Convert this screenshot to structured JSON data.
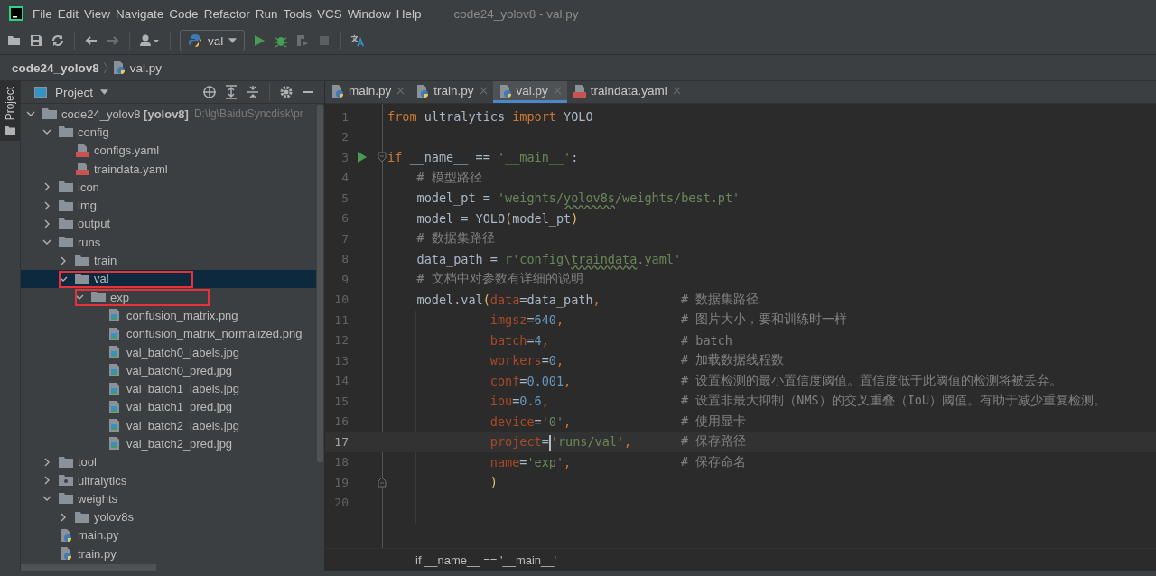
{
  "window": {
    "title": "code24_yolov8 - val.py"
  },
  "menu": [
    "File",
    "Edit",
    "View",
    "Navigate",
    "Code",
    "Refactor",
    "Run",
    "Tools",
    "VCS",
    "Window",
    "Help"
  ],
  "toolbar": {
    "run_config": "val"
  },
  "breadcrumb": [
    "code24_yolov8",
    "val.py"
  ],
  "side_tab": {
    "label": "Project",
    "selected": true
  },
  "project_panel": {
    "title": "Project"
  },
  "tree": [
    {
      "kind": "folder",
      "label": "code24_yolov8 **[yolov8]**",
      "path": "D:\\lg\\BaiduSyncdisk\\pr",
      "expanded": true,
      "selected": false,
      "boxed": false,
      "children": [
        {
          "kind": "folder",
          "label": "config",
          "expanded": true,
          "selected": false,
          "boxed": false,
          "children": [
            {
              "kind": "yaml",
              "label": "configs.yaml",
              "selected": false,
              "boxed": false
            },
            {
              "kind": "yaml",
              "label": "traindata.yaml",
              "selected": false,
              "boxed": false
            }
          ]
        },
        {
          "kind": "folder",
          "label": "icon",
          "expanded": false,
          "selected": false,
          "boxed": false
        },
        {
          "kind": "folder",
          "label": "img",
          "expanded": false,
          "selected": false,
          "boxed": false
        },
        {
          "kind": "folder",
          "label": "output",
          "expanded": false,
          "selected": false,
          "boxed": false
        },
        {
          "kind": "folder",
          "label": "runs",
          "expanded": true,
          "selected": false,
          "boxed": false,
          "children": [
            {
              "kind": "folder",
              "label": "train",
              "expanded": false,
              "selected": false,
              "boxed": false
            },
            {
              "kind": "folder",
              "label": "val",
              "expanded": true,
              "selected": true,
              "boxed": true,
              "children": [
                {
                  "kind": "folder",
                  "label": "exp",
                  "expanded": true,
                  "selected": false,
                  "boxed": true,
                  "children": [
                    {
                      "kind": "image",
                      "label": "confusion_matrix.png",
                      "selected": false,
                      "boxed": false
                    },
                    {
                      "kind": "image",
                      "label": "confusion_matrix_normalized.png",
                      "selected": false,
                      "boxed": false
                    },
                    {
                      "kind": "image",
                      "label": "val_batch0_labels.jpg",
                      "selected": false,
                      "boxed": false
                    },
                    {
                      "kind": "image",
                      "label": "val_batch0_pred.jpg",
                      "selected": false,
                      "boxed": false
                    },
                    {
                      "kind": "image",
                      "label": "val_batch1_labels.jpg",
                      "selected": false,
                      "boxed": false
                    },
                    {
                      "kind": "image",
                      "label": "val_batch1_pred.jpg",
                      "selected": false,
                      "boxed": false
                    },
                    {
                      "kind": "image",
                      "label": "val_batch2_labels.jpg",
                      "selected": false,
                      "boxed": false
                    },
                    {
                      "kind": "image",
                      "label": "val_batch2_pred.jpg",
                      "selected": false,
                      "boxed": false
                    }
                  ]
                }
              ]
            }
          ]
        },
        {
          "kind": "folder",
          "label": "tool",
          "expanded": false,
          "selected": false,
          "boxed": false
        },
        {
          "kind": "package",
          "label": "ultralytics",
          "expanded": false,
          "selected": false,
          "boxed": false
        },
        {
          "kind": "folder",
          "label": "weights",
          "expanded": true,
          "selected": false,
          "boxed": false,
          "children": [
            {
              "kind": "folder",
              "label": "yolov8s",
              "expanded": false,
              "selected": false,
              "boxed": false
            }
          ]
        },
        {
          "kind": "python",
          "label": "main.py",
          "selected": false,
          "boxed": false
        },
        {
          "kind": "python",
          "label": "train.py",
          "selected": false,
          "boxed": false
        }
      ]
    }
  ],
  "tabs": [
    {
      "kind": "python",
      "label": "main.py",
      "selected": false
    },
    {
      "kind": "python",
      "label": "train.py",
      "selected": false
    },
    {
      "kind": "python",
      "label": "val.py",
      "selected": true
    },
    {
      "kind": "yaml",
      "label": "traindata.yaml",
      "selected": false
    }
  ],
  "code_lines": [
    {
      "number": "1",
      "run": false,
      "current": false,
      "tokens": [
        {
          "kind": "kw",
          "text": "from"
        },
        {
          "kind": "plain",
          "text": " ultralytics "
        },
        {
          "kind": "kw",
          "text": "import"
        },
        {
          "kind": "plain",
          "text": " YOLO"
        }
      ]
    },
    {
      "number": "2",
      "run": false,
      "current": false
    },
    {
      "number": "3",
      "run": true,
      "current": false,
      "fold_start": true,
      "tokens": [
        {
          "kind": "kw",
          "text": "if"
        },
        {
          "kind": "plain",
          "text": " __name__ == "
        },
        {
          "kind": "str",
          "text": "'__main__'"
        },
        {
          "kind": "plain",
          "text": ":"
        }
      ]
    },
    {
      "number": "4",
      "run": false,
      "current": false,
      "tokens": [
        {
          "kind": "comment",
          "text": "    # 模型路径"
        }
      ]
    },
    {
      "number": "5",
      "run": false,
      "current": false,
      "tokens": [
        {
          "kind": "plain",
          "text": "    model_pt = "
        },
        {
          "kind": "str",
          "text": "'weights/"
        },
        {
          "kind": "str",
          "text": "yolov8s",
          "squiggle": true
        },
        {
          "kind": "str",
          "text": "/weights/best.pt'"
        }
      ]
    },
    {
      "number": "6",
      "run": false,
      "current": false,
      "tokens": [
        {
          "kind": "plain",
          "text": "    model = YOLO"
        },
        {
          "kind": "paren",
          "text": "("
        },
        {
          "kind": "plain",
          "text": "model_pt"
        },
        {
          "kind": "paren",
          "text": ")"
        }
      ]
    },
    {
      "number": "7",
      "run": false,
      "current": false,
      "tokens": [
        {
          "kind": "comment",
          "text": "    # 数据集路径"
        }
      ]
    },
    {
      "number": "8",
      "run": false,
      "current": false,
      "tokens": [
        {
          "kind": "plain",
          "text": "    data_path = "
        },
        {
          "kind": "str",
          "text": "r'config\\"
        },
        {
          "kind": "str",
          "text": "traindata",
          "squiggle": true
        },
        {
          "kind": "str",
          "text": ".yaml'"
        }
      ]
    },
    {
      "number": "9",
      "run": false,
      "current": false,
      "tokens": [
        {
          "kind": "comment",
          "text": "    # 文档中对参数有详细的说明"
        }
      ]
    },
    {
      "number": "10",
      "run": false,
      "current": false,
      "comment": "# 数据集路径",
      "tokens": [
        {
          "kind": "plain",
          "text": "    model.val"
        },
        {
          "kind": "paren",
          "text": "("
        },
        {
          "kind": "param",
          "text": "data"
        },
        {
          "kind": "plain",
          "text": "=data_path"
        },
        {
          "kind": "kw",
          "text": ","
        }
      ]
    },
    {
      "number": "11",
      "run": false,
      "current": false,
      "comment": "# 图片大小，要和训练时一样",
      "tokens": [
        {
          "kind": "param",
          "text": "              imgsz"
        },
        {
          "kind": "plain",
          "text": "="
        },
        {
          "kind": "num",
          "text": "640"
        },
        {
          "kind": "kw",
          "text": ","
        }
      ]
    },
    {
      "number": "12",
      "run": false,
      "current": false,
      "comment": "# batch",
      "tokens": [
        {
          "kind": "param",
          "text": "              batch"
        },
        {
          "kind": "plain",
          "text": "="
        },
        {
          "kind": "num",
          "text": "4"
        },
        {
          "kind": "kw",
          "text": ","
        }
      ]
    },
    {
      "number": "13",
      "run": false,
      "current": false,
      "comment": "# 加载数据线程数",
      "tokens": [
        {
          "kind": "param",
          "text": "              workers"
        },
        {
          "kind": "plain",
          "text": "="
        },
        {
          "kind": "num",
          "text": "0"
        },
        {
          "kind": "kw",
          "text": ","
        }
      ]
    },
    {
      "number": "14",
      "run": false,
      "current": false,
      "comment": "# 设置检测的最小置信度阈值。置信度低于此阈值的检测将被丢弃。",
      "tokens": [
        {
          "kind": "param",
          "text": "              conf"
        },
        {
          "kind": "plain",
          "text": "="
        },
        {
          "kind": "num",
          "text": "0.001"
        },
        {
          "kind": "kw",
          "text": ","
        }
      ]
    },
    {
      "number": "15",
      "run": false,
      "current": false,
      "comment": "# 设置非最大抑制（NMS）的交叉重叠（IoU）阈值。有助于减少重复检测。",
      "tokens": [
        {
          "kind": "param",
          "text": "              iou"
        },
        {
          "kind": "plain",
          "text": "="
        },
        {
          "kind": "num",
          "text": "0.6"
        },
        {
          "kind": "kw",
          "text": ","
        }
      ]
    },
    {
      "number": "16",
      "run": false,
      "current": false,
      "comment": "# 使用显卡",
      "tokens": [
        {
          "kind": "param",
          "text": "              device"
        },
        {
          "kind": "plain",
          "text": "="
        },
        {
          "kind": "str",
          "text": "'0'"
        },
        {
          "kind": "kw",
          "text": ","
        }
      ]
    },
    {
      "number": "17",
      "run": false,
      "current": true,
      "comment": "# 保存路径",
      "tokens": [
        {
          "kind": "param",
          "text": "              project"
        },
        {
          "kind": "plain",
          "text": "="
        },
        {
          "kind": "caret"
        },
        {
          "kind": "str",
          "text": "'runs/val'"
        },
        {
          "kind": "kw",
          "text": ","
        }
      ]
    },
    {
      "number": "18",
      "run": false,
      "current": false,
      "comment": "# 保存命名",
      "tokens": [
        {
          "kind": "param",
          "text": "              name"
        },
        {
          "kind": "plain",
          "text": "="
        },
        {
          "kind": "str",
          "text": "'exp'"
        },
        {
          "kind": "kw",
          "text": ","
        }
      ]
    },
    {
      "number": "19",
      "run": false,
      "current": false,
      "fold_end": true,
      "tokens": [
        {
          "kind": "paren",
          "text": "              )"
        }
      ]
    },
    {
      "number": "20",
      "run": false,
      "current": false
    }
  ],
  "editor_breadcrumb": "if __name__ == '__main__'"
}
